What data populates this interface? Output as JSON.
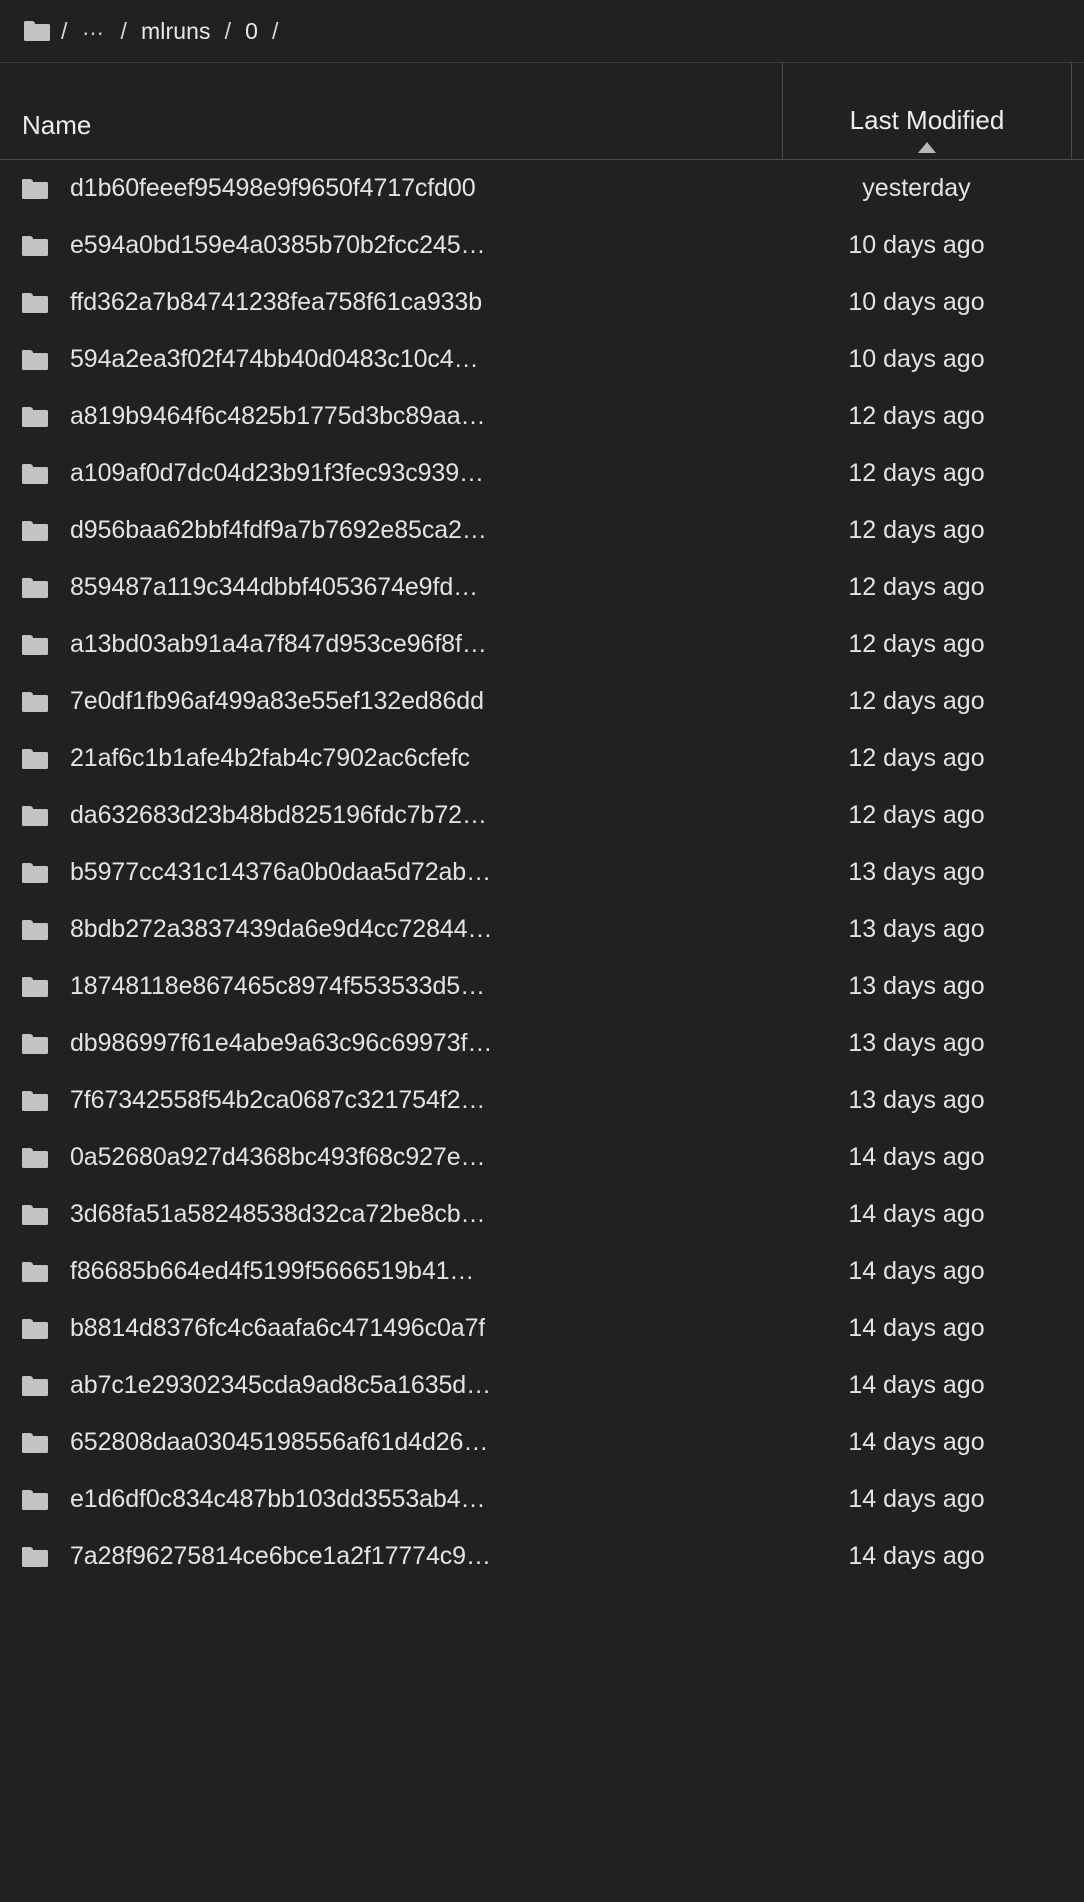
{
  "breadcrumb": {
    "home_icon": "folder-icon",
    "separator": "/",
    "ellipsis": "…",
    "segments": [
      "mlruns",
      "0"
    ],
    "trailing_separator": "/"
  },
  "table": {
    "columns": {
      "name": "Name",
      "last_modified": "Last Modified"
    },
    "sort": {
      "column": "Last Modified",
      "direction": "ascending",
      "icon": "caret-up-icon"
    },
    "row_icon": "folder-icon",
    "rows": [
      {
        "name": "d1b60feeef95498e9f9650f4717cfd00",
        "last_modified": "yesterday"
      },
      {
        "name": "e594a0bd159e4a0385b70b2fcc245…",
        "last_modified": "10 days ago"
      },
      {
        "name": "ffd362a7b84741238fea758f61ca933b",
        "last_modified": "10 days ago"
      },
      {
        "name": "594a2ea3f02f474bb40d0483c10c4…",
        "last_modified": "10 days ago"
      },
      {
        "name": "a819b9464f6c4825b1775d3bc89aa…",
        "last_modified": "12 days ago"
      },
      {
        "name": "a109af0d7dc04d23b91f3fec93c939…",
        "last_modified": "12 days ago"
      },
      {
        "name": "d956baa62bbf4fdf9a7b7692e85ca2…",
        "last_modified": "12 days ago"
      },
      {
        "name": "859487a119c344dbbf4053674e9fd…",
        "last_modified": "12 days ago"
      },
      {
        "name": "a13bd03ab91a4a7f847d953ce96f8f…",
        "last_modified": "12 days ago"
      },
      {
        "name": "7e0df1fb96af499a83e55ef132ed86dd",
        "last_modified": "12 days ago"
      },
      {
        "name": "21af6c1b1afe4b2fab4c7902ac6cfefc",
        "last_modified": "12 days ago"
      },
      {
        "name": "da632683d23b48bd825196fdc7b72…",
        "last_modified": "12 days ago"
      },
      {
        "name": "b5977cc431c14376a0b0daa5d72ab…",
        "last_modified": "13 days ago"
      },
      {
        "name": "8bdb272a3837439da6e9d4cc72844…",
        "last_modified": "13 days ago"
      },
      {
        "name": "18748118e867465c8974f553533d5…",
        "last_modified": "13 days ago"
      },
      {
        "name": "db986997f61e4abe9a63c96c69973f…",
        "last_modified": "13 days ago"
      },
      {
        "name": "7f67342558f54b2ca0687c321754f2…",
        "last_modified": "13 days ago"
      },
      {
        "name": "0a52680a927d4368bc493f68c927e…",
        "last_modified": "14 days ago"
      },
      {
        "name": "3d68fa51a58248538d32ca72be8cb…",
        "last_modified": "14 days ago"
      },
      {
        "name": "f86685b664ed4f5199f5666519b41…",
        "last_modified": "14 days ago"
      },
      {
        "name": "b8814d8376fc4c6aafa6c471496c0a7f",
        "last_modified": "14 days ago"
      },
      {
        "name": "ab7c1e29302345cda9ad8c5a1635d…",
        "last_modified": "14 days ago"
      },
      {
        "name": "652808daa03045198556af61d4d26…",
        "last_modified": "14 days ago"
      },
      {
        "name": "e1d6df0c834c487bb103dd3553ab4…",
        "last_modified": "14 days ago"
      },
      {
        "name": "7a28f96275814ce6bce1a2f17774c9…",
        "last_modified": "14 days ago"
      }
    ]
  },
  "colors": {
    "background": "#212121",
    "text": "#e3e3e3",
    "icon": "#c3c3c3",
    "divider": "#4d4d4d"
  }
}
